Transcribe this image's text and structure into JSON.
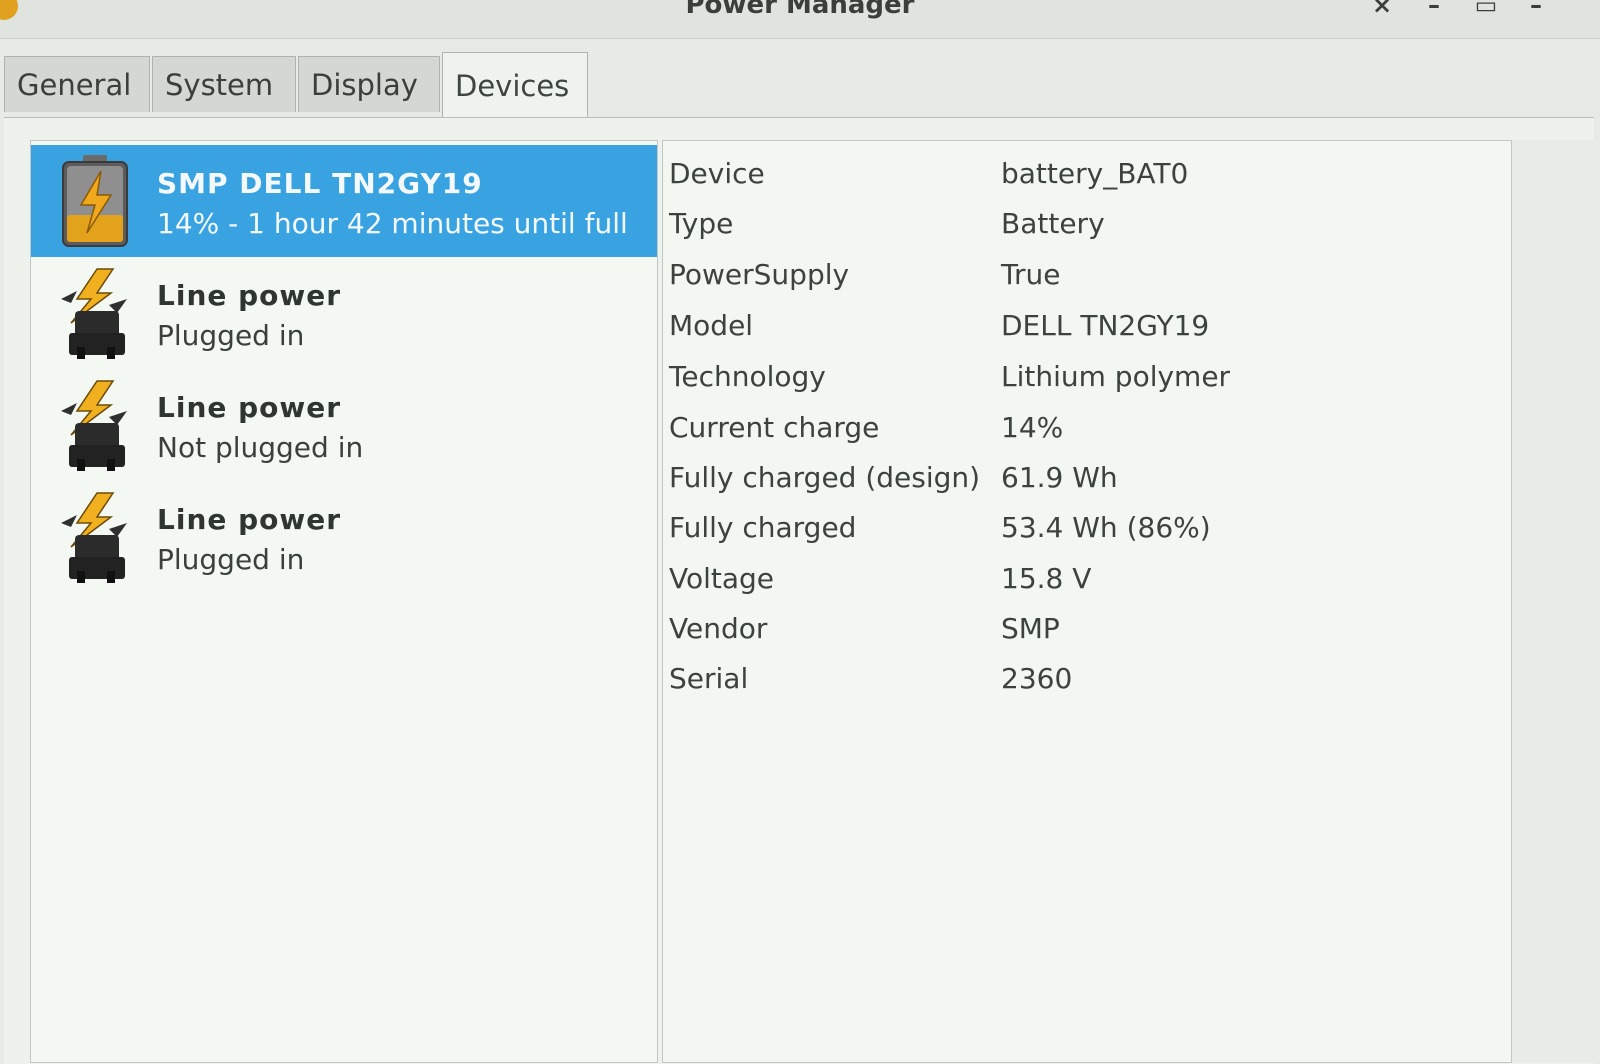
{
  "window": {
    "title": "Power Manager"
  },
  "tabs": [
    {
      "label": "General"
    },
    {
      "label": "System"
    },
    {
      "label": "Display"
    },
    {
      "label": "Devices"
    }
  ],
  "devices": [
    {
      "name": "SMP DELL TN2GY19",
      "status": "14% - 1 hour 42 minutes until full",
      "icon": "battery-charging-icon",
      "selected": true
    },
    {
      "name": "Line power",
      "status": "Plugged in",
      "icon": "ac-adapter-icon",
      "selected": false
    },
    {
      "name": "Line power",
      "status": "Not plugged in",
      "icon": "ac-adapter-icon",
      "selected": false
    },
    {
      "name": "Line power",
      "status": "Plugged in",
      "icon": "ac-adapter-icon",
      "selected": false
    }
  ],
  "details": [
    {
      "key": "Device",
      "value": "battery_BAT0"
    },
    {
      "key": "Type",
      "value": "Battery"
    },
    {
      "key": "PowerSupply",
      "value": "True"
    },
    {
      "key": "Model",
      "value": "DELL TN2GY19"
    },
    {
      "key": "Technology",
      "value": "Lithium polymer"
    },
    {
      "key": "Current charge",
      "value": "14%"
    },
    {
      "key": "Fully charged (design)",
      "value": "61.9 Wh"
    },
    {
      "key": "Fully charged",
      "value": "53.4 Wh (86%)"
    },
    {
      "key": "Voltage",
      "value": "15.8 V"
    },
    {
      "key": "Vendor",
      "value": "SMP"
    },
    {
      "key": "Serial",
      "value": "2360"
    }
  ],
  "colors": {
    "selection": "#39a2e0",
    "battery": "#e0a020"
  }
}
